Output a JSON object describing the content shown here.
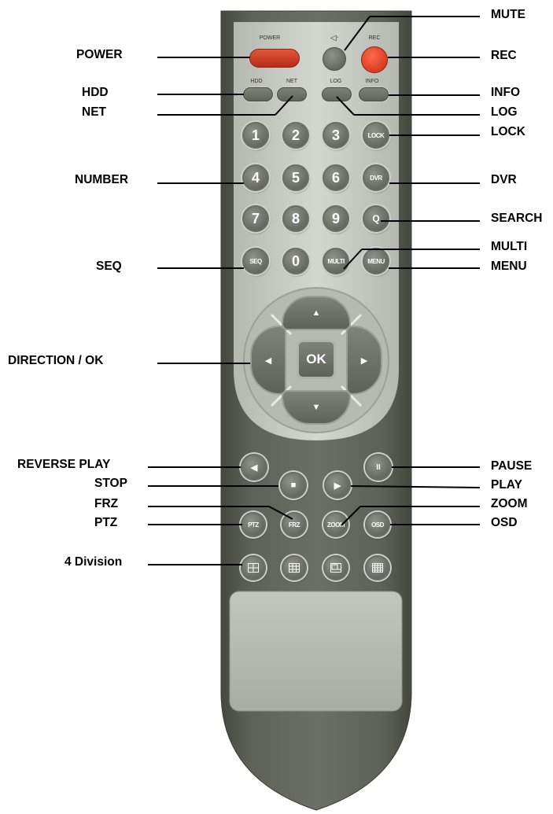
{
  "colors": {
    "body_dark": "#5b5f57",
    "panel_light": "#c9ccc6",
    "button_gray": "#6e726a",
    "button_red": "#d83a1c"
  },
  "remote": {
    "silk": {
      "power": "POWER",
      "rec": "REC",
      "hdd": "HDD",
      "net": "NET",
      "log": "LOG",
      "info": "INFO"
    },
    "numbers": [
      "1",
      "2",
      "3",
      "4",
      "5",
      "6",
      "7",
      "8",
      "9",
      "0"
    ],
    "keys": {
      "lock": "LOCK",
      "dvr": "DVR",
      "search": "Q",
      "seq": "SEQ",
      "multi": "MULTI",
      "menu": "MENU",
      "ok": "OK",
      "ptz": "PTZ",
      "frz": "FRZ",
      "zoom": "ZOOM",
      "osd": "OSD"
    },
    "arrows": {
      "up": "▲",
      "down": "▼",
      "left": "◀",
      "right": "▶"
    },
    "transport": {
      "reverse": "◀",
      "stop": "■",
      "play": "▶",
      "pause": "II"
    }
  },
  "callouts": {
    "mute": "MUTE",
    "power": "POWER",
    "rec": "REC",
    "hdd": "HDD",
    "info": "INFO",
    "net": "NET",
    "log": "LOG",
    "lock": "LOCK",
    "number": "NUMBER",
    "dvr": "DVR",
    "search": "SEARCH",
    "multi": "MULTI",
    "seq": "SEQ",
    "menu": "MENU",
    "direction": "DIRECTION / OK",
    "reverse_play": "REVERSE PLAY",
    "pause": "PAUSE",
    "stop": "STOP",
    "play": "PLAY",
    "frz": "FRZ",
    "zoom": "ZOOM",
    "ptz": "PTZ",
    "osd": "OSD",
    "division": "4 Division"
  }
}
